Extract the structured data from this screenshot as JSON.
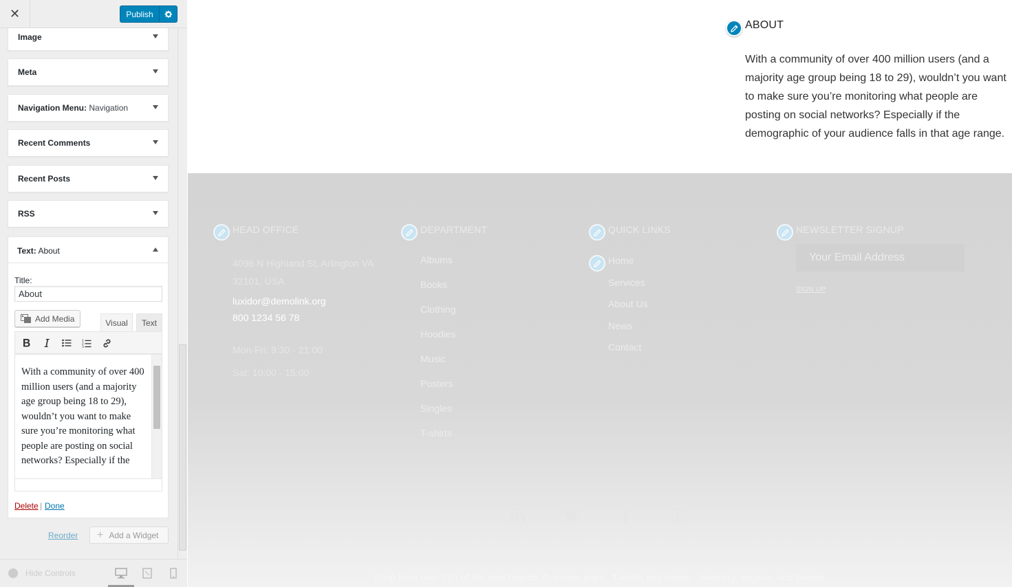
{
  "header": {
    "close_icon": "close-icon",
    "publish_label": "Publish",
    "settings_icon": "gear-icon"
  },
  "widgets": [
    {
      "title": "Image",
      "subtitle": ""
    },
    {
      "title": "Meta",
      "subtitle": ""
    },
    {
      "title": "Navigation Menu:",
      "subtitle": " Navigation"
    },
    {
      "title": "Recent Comments",
      "subtitle": ""
    },
    {
      "title": "Recent Posts",
      "subtitle": ""
    },
    {
      "title": "RSS",
      "subtitle": ""
    }
  ],
  "text_widget": {
    "title": "Text:",
    "subtitle": " About",
    "title_label": "Title:",
    "title_value": "About",
    "add_media_label": "Add Media",
    "tab_visual": "Visual",
    "tab_text": "Text",
    "content": "With a community of over 400 million users (and a majority age group being 18 to 29), wouldn’t you want to make sure you’re monitoring what people are posting on social networks? Especially if the",
    "delete_label": "Delete",
    "separator": "|",
    "done_label": "Done"
  },
  "actions": {
    "reorder_label": "Reorder",
    "add_widget_label": "Add a Widget"
  },
  "sidebar_footer": {
    "hide_controls_label": "Hide Controls"
  },
  "preview": {
    "about_title": "ABOUT",
    "about_text": "With a community of over 400 million users (and a majority age group being 18 to 29), wouldn’t you want to make sure you’re monitoring what people are posting on social networks? Especially if the demographic of your audience falls in that age range.",
    "footer": {
      "head_office": {
        "title": "HEAD OFFICE",
        "address_line1": "4096 N Highland St, Arlington VA",
        "address_line2": "32101, USA",
        "email": "luxidor@demolink.org",
        "phone": "800 1234 56 78",
        "hours1": "Mon-Fri: 9:30 - 21:00",
        "hours2": "Sat: 10:00 - 15:00"
      },
      "department": {
        "title": "DEPARTMENT",
        "items": [
          "Albums",
          "Books",
          "Clothing",
          "Hoodies",
          "Music",
          "Posters",
          "Singles",
          "T-shirts"
        ]
      },
      "quick_links": {
        "title": "QUICK LINKS",
        "items": [
          "Home",
          "Services",
          "About Us",
          "News",
          "Contact"
        ]
      },
      "newsletter": {
        "title": "NEWSLETTER SIGNUP",
        "placeholder": "Your Email Address",
        "signup_label": "SIGN UP"
      },
      "social": [
        "linkedin-icon",
        "twitter-icon",
        "facebook-icon",
        "instagram-icon"
      ],
      "bottom_text": "Shop from over 750 of the best brands. Dresses, jeans, T-shirts and shoes. Jewellery, lingerie, and beauty."
    }
  },
  "colors": {
    "accent": "#0085ba",
    "link": "#0073aa",
    "delete": "#aa0000"
  }
}
